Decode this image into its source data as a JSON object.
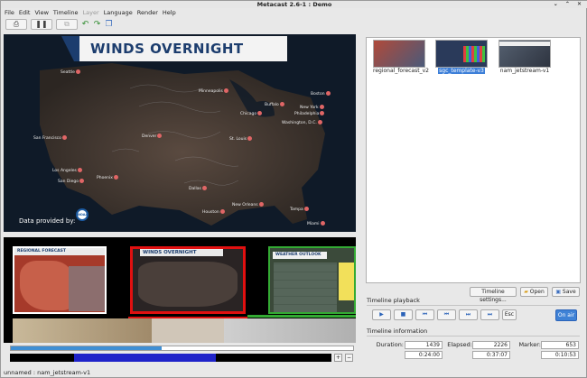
{
  "window": {
    "title": "Metacast 2.6-1 : Demo",
    "controls": "⌄ ⌃ ✕"
  },
  "menu": [
    {
      "label": "File",
      "enabled": true
    },
    {
      "label": "Edit",
      "enabled": true
    },
    {
      "label": "View",
      "enabled": true
    },
    {
      "label": "Timeline",
      "enabled": true
    },
    {
      "label": "Layer",
      "enabled": false
    },
    {
      "label": "Language",
      "enabled": true
    },
    {
      "label": "Render",
      "enabled": true
    },
    {
      "label": "Help",
      "enabled": true
    }
  ],
  "toolbar": {
    "icons": [
      "printer-icon",
      "pause-icon",
      "layers-icon",
      "undo-icon",
      "redo-icon",
      "copy-icon"
    ]
  },
  "preview": {
    "title": "WINDS OVERNIGHT",
    "credit": "Data provided by:",
    "logo": "NOAA",
    "cities": [
      {
        "name": "Seattle"
      },
      {
        "name": "Minneapolis"
      },
      {
        "name": "Boston"
      },
      {
        "name": "New York"
      },
      {
        "name": "Philadelphia"
      },
      {
        "name": "Buffalo"
      },
      {
        "name": "Washington, D.C."
      },
      {
        "name": "Chicago"
      },
      {
        "name": "Denver"
      },
      {
        "name": "San Francisco"
      },
      {
        "name": "St. Louis"
      },
      {
        "name": "Los Angeles"
      },
      {
        "name": "San Diego"
      },
      {
        "name": "Phoenix"
      },
      {
        "name": "Dallas"
      },
      {
        "name": "Houston"
      },
      {
        "name": "New Orleans"
      },
      {
        "name": "Tampa"
      },
      {
        "name": "Miami"
      }
    ]
  },
  "timeline": {
    "clips": [
      {
        "label": "REGIONAL FORECAST"
      },
      {
        "label": "WINDS OVERNIGHT"
      },
      {
        "label": "WEATHER OUTLOOK"
      }
    ],
    "scroll_progress": 0.44
  },
  "status": "unnamed : nam_jetstream-v1",
  "templates": [
    {
      "name": "regional_forecast_v2",
      "selected": false
    },
    {
      "name": "sgc_template-v3",
      "selected": true
    },
    {
      "name": "nam_jetstream-v1",
      "selected": false
    }
  ],
  "panel_buttons": {
    "settings": "Timeline settings...",
    "open": "Open",
    "save": "Save"
  },
  "playback": {
    "heading": "Timeline playback",
    "buttons": [
      "▶",
      "■",
      "⏮",
      "⏮",
      "⏭",
      "⏭"
    ],
    "esc": "Esc",
    "on_air": "On air"
  },
  "info": {
    "heading": "Timeline information",
    "duration_label": "Duration:",
    "duration_frames": "1439",
    "duration_time": "0:24:00",
    "elapsed_label": "Elapsed:",
    "elapsed_frames": "2226",
    "elapsed_time": "0:37:07",
    "marker_label": "Marker:",
    "marker_frames": "653",
    "marker_time": "0:10:53"
  }
}
